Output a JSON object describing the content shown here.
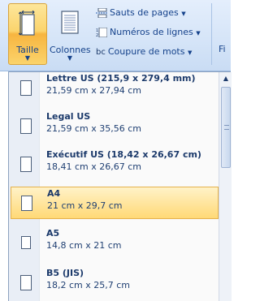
{
  "ribbon": {
    "taille_label": "Taille",
    "colonnes_label": "Colonnes",
    "sauts_label": "Sauts de pages",
    "numeros_label": "Numéros de lignes",
    "coupure_label": "Coupure de mots",
    "coupure_icon_text": "bc",
    "cropped_label": "Fi"
  },
  "page_sizes": [
    {
      "title": "Lettre US (215,9 x 279,4 mm)",
      "dims": "21,59 cm x 27,94 cm"
    },
    {
      "title": "Legal US",
      "dims": "21,59 cm x 35,56 cm"
    },
    {
      "title": "Exécutif US (18,42 x 26,67 cm)",
      "dims": "18,41 cm x 26,67 cm"
    },
    {
      "title": "A4",
      "dims": "21 cm x 29,7 cm",
      "selected": true
    },
    {
      "title": "A5",
      "dims": "14,8 cm x 21 cm"
    },
    {
      "title": "B5 (JIS)",
      "dims": "18,2 cm x 25,7 cm"
    }
  ],
  "colors": {
    "selected_bg": "#ffd976",
    "ribbon_bg": "#d6e5f8",
    "text": "#15428b"
  }
}
